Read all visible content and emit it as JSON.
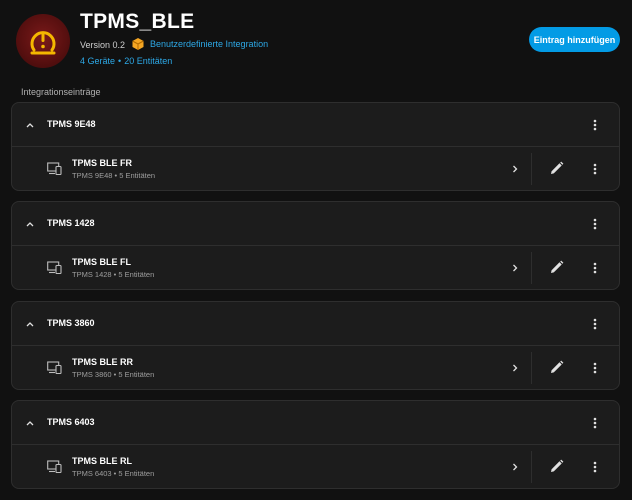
{
  "header": {
    "title": "TPMS_BLE",
    "version": "Version 0.2",
    "custom_integration": "Benutzerdefinierte Integration",
    "devices_link": "4 Geräte",
    "entities_link": "20 Entitäten",
    "add_entry_button": "Eintrag hinzufügen",
    "logo_icon": "tire-pressure-warning-icon"
  },
  "section_title": "Integrationseinträge",
  "colors": {
    "accent": "#039be5",
    "link": "#2da8e6",
    "background": "#111111",
    "card": "#1c1c1c"
  },
  "entries": [
    {
      "title": "TPMS 9E48",
      "device": "TPMS BLE FR",
      "subtitle": "TPMS 9E48 • 5 Entitäten"
    },
    {
      "title": "TPMS 1428",
      "device": "TPMS BLE FL",
      "subtitle": "TPMS 1428 • 5 Entitäten"
    },
    {
      "title": "TPMS 3860",
      "device": "TPMS BLE RR",
      "subtitle": "TPMS 3860 • 5 Entitäten"
    },
    {
      "title": "TPMS 6403",
      "device": "TPMS BLE RL",
      "subtitle": "TPMS 6403 • 5 Entitäten"
    }
  ]
}
